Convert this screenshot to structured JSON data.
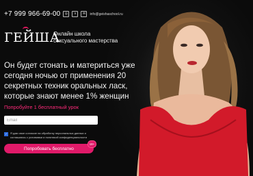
{
  "header": {
    "phone": "+7 999 966-69-00",
    "social_icons": [
      "instagram-icon",
      "vk-icon"
    ],
    "email": "info@geishaschool.ru"
  },
  "brand": {
    "logo": "ГЕЙША",
    "tagline_line1": "Онлайн школа",
    "tagline_line2": "сексуального мастерства"
  },
  "hero": {
    "headline": "Он будет стонать и материться уже сегодня ночью от применения 20 секретных техник оральных ласк, которые знают менее 1% женщин"
  },
  "form": {
    "cta_label": "Попробуйте 1 бесплатный урок",
    "email_placeholder": "Email",
    "consent_text": "Я даю свое согласие на обработку персональных данных и соглашаюсь с условиями и политикой конфиденциальности",
    "consent_checked": true,
    "submit_label": "Попробовать бесплатно",
    "badge_text": "18+"
  },
  "colors": {
    "accent": "#e01a69",
    "background": "#0d0d0d",
    "dress": "#d21a2a"
  }
}
